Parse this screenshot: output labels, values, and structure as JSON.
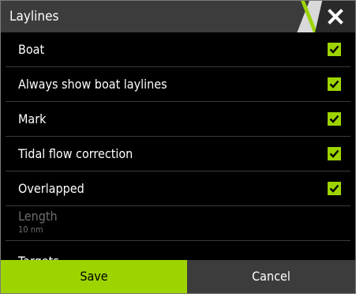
{
  "dialog": {
    "title": "Laylines",
    "close_icon": "close-icon"
  },
  "rows": [
    {
      "label": "Boat",
      "checked": true
    },
    {
      "label": "Always show boat laylines",
      "checked": true
    },
    {
      "label": "Mark",
      "checked": true
    },
    {
      "label": "Tidal flow correction",
      "checked": true
    },
    {
      "label": "Overlapped",
      "checked": true
    }
  ],
  "length": {
    "label": "Length",
    "value": "10 nm"
  },
  "targets": {
    "label": "Targets..."
  },
  "buttons": {
    "save": "Save",
    "cancel": "Cancel"
  },
  "colors": {
    "accent": "#9dd400",
    "title_bg": "#3c3c3c",
    "background": "#000000"
  }
}
